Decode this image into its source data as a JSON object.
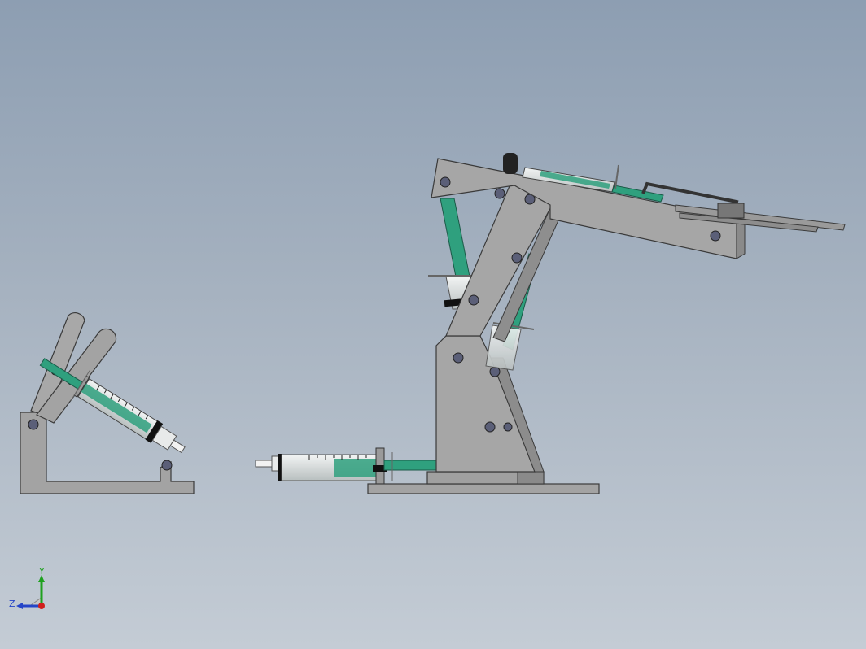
{
  "viewport": {
    "background_top": "#8d9eb2",
    "background_bottom": "#c4ccd5"
  },
  "colors": {
    "part_fill": "#a3a3a3",
    "part_stroke": "#3a3a3a",
    "syringe_green": "#2fa07e",
    "syringe_barrel": "#d8dcdc",
    "hole_fill": "#5b5f78",
    "triad_x": "#d0201c",
    "triad_y": "#1fa11f",
    "triad_z": "#2545c8"
  },
  "triad": {
    "x_label": "",
    "y_label": "Y",
    "z_label": "Z"
  }
}
